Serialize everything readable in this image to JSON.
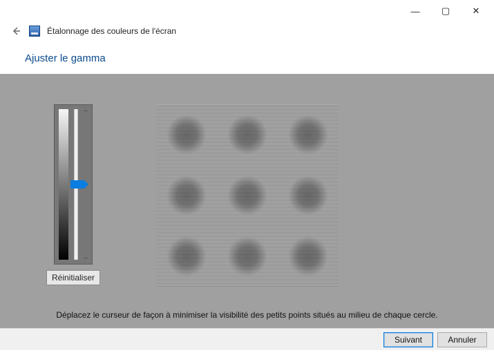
{
  "window": {
    "title": "Étalonnage des couleurs de l'écran",
    "controls": {
      "minimize": "—",
      "maximize": "▢",
      "close": "✕"
    }
  },
  "heading": "Ajuster le gamma",
  "slider": {
    "reset_label": "Réinitialiser"
  },
  "instruction": "Déplacez le curseur de façon à minimiser la visibilité des petits points situés au milieu de chaque cercle.",
  "footer": {
    "next": "Suivant",
    "cancel": "Annuler"
  }
}
